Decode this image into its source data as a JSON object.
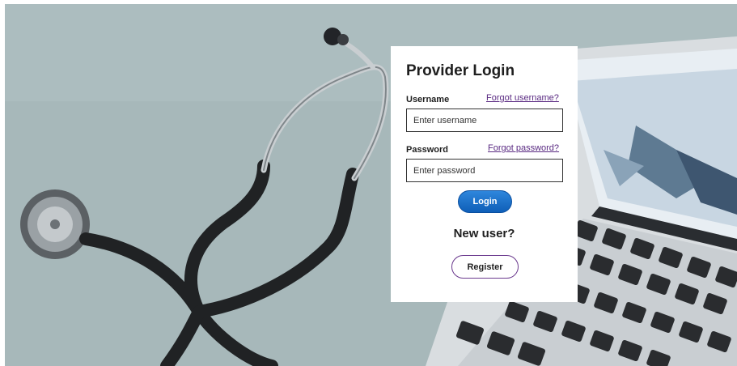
{
  "login": {
    "title": "Provider Login",
    "username_label": "Username",
    "forgot_username": "Forgot username?",
    "username_placeholder": "Enter username",
    "password_label": "Password",
    "forgot_password": "Forgot password?",
    "password_placeholder": "Enter password",
    "login_button": "Login",
    "new_user_text": "New user?",
    "register_button": "Register"
  },
  "colors": {
    "background": "#a9b9bb",
    "link": "#5a2a82",
    "login_button": "#1e6fc8",
    "register_border": "#6b3a8e"
  }
}
